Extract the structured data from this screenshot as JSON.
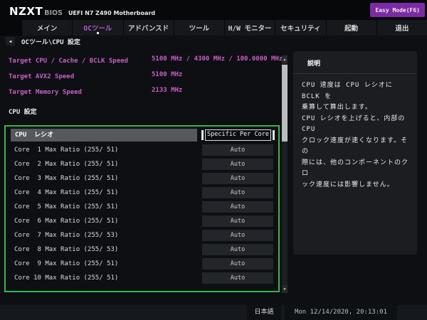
{
  "header": {
    "brand": "NZXT",
    "brand_sub": "BIOS",
    "board": "UEFI N7 Z490 Motherboard",
    "easy_mode_label": "Easy Mode(F6)"
  },
  "tabs": [
    "メイン",
    "OCツール",
    "アドバンスド",
    "ツール",
    "H/W モニター",
    "セキュリティ",
    "起動",
    "退出"
  ],
  "active_tab": "OCツール",
  "breadcrumb": {
    "path": "OCツール\\CPU 設定"
  },
  "icons": {
    "back": "◀",
    "scroll_up": "▲",
    "scroll_down": "▼"
  },
  "targets": [
    {
      "label": "Target CPU / Cache / BCLK Speed",
      "value": "5100 MHz / 4300 MHz / 100.0000 MHz"
    },
    {
      "label": "Target AVX2 Speed",
      "value": "5100 MHz"
    },
    {
      "label": "Target Memory Speed",
      "value": "2133 MHz"
    }
  ],
  "section_title": "CPU 設定",
  "cpu_table": {
    "header_label": "CPU  レシオ",
    "header_value": "Specific Per Core",
    "rows": [
      {
        "label": "Core  1 Max Ratio (255/ 51)",
        "value": "Auto"
      },
      {
        "label": "Core  2 Max Ratio (255/ 51)",
        "value": "Auto"
      },
      {
        "label": "Core  3 Max Ratio (255/ 51)",
        "value": "Auto"
      },
      {
        "label": "Core  4 Max Ratio (255/ 51)",
        "value": "Auto"
      },
      {
        "label": "Core  5 Max Ratio (255/ 51)",
        "value": "Auto"
      },
      {
        "label": "Core  6 Max Ratio (255/ 51)",
        "value": "Auto"
      },
      {
        "label": "Core  7 Max Ratio (255/ 53)",
        "value": "Auto"
      },
      {
        "label": "Core  8 Max Ratio (255/ 53)",
        "value": "Auto"
      },
      {
        "label": "Core  9 Max Ratio (255/ 51)",
        "value": "Auto"
      },
      {
        "label": "Core 10 Max Ratio (255/ 51)",
        "value": "Auto"
      }
    ]
  },
  "help_panel": {
    "title": "説明",
    "body": "CPU 速度は CPU レシオに BCLK を\n乗算して算出します。\nCPU レシオを上げると、内部の CPU\nクロック速度が速くなります。その\n際には、他のコンポーネントのクロ\nック速度には影響しません。"
  },
  "footer": {
    "language": "日本語",
    "datetime": "Mon 12/14/2020, 20:13:01"
  },
  "colors": {
    "accent": "#7c2ba5",
    "tab-active": "#ab5fc9",
    "magenta": "#c75fc7",
    "green": "#2eb84f"
  }
}
